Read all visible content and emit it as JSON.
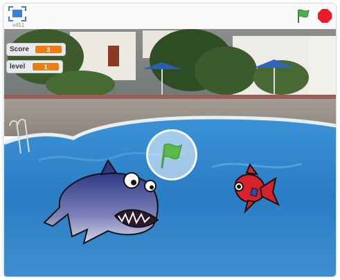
{
  "toolbar": {
    "version": "v451",
    "fullscreen_icon": "fullscreen-icon",
    "green_flag_icon": "green-flag-icon",
    "stop_icon": "stop-icon"
  },
  "monitors": [
    {
      "label": "Score",
      "value": "3"
    },
    {
      "label": "level",
      "value": "1"
    }
  ],
  "sprites": [
    "shark",
    "red-fish"
  ],
  "colors": {
    "accent_orange": "#ee7d16",
    "flag_green": "#4cae4c",
    "stop_red": "#ec1c24",
    "fullscreen_blue": "#3a7fd0"
  }
}
